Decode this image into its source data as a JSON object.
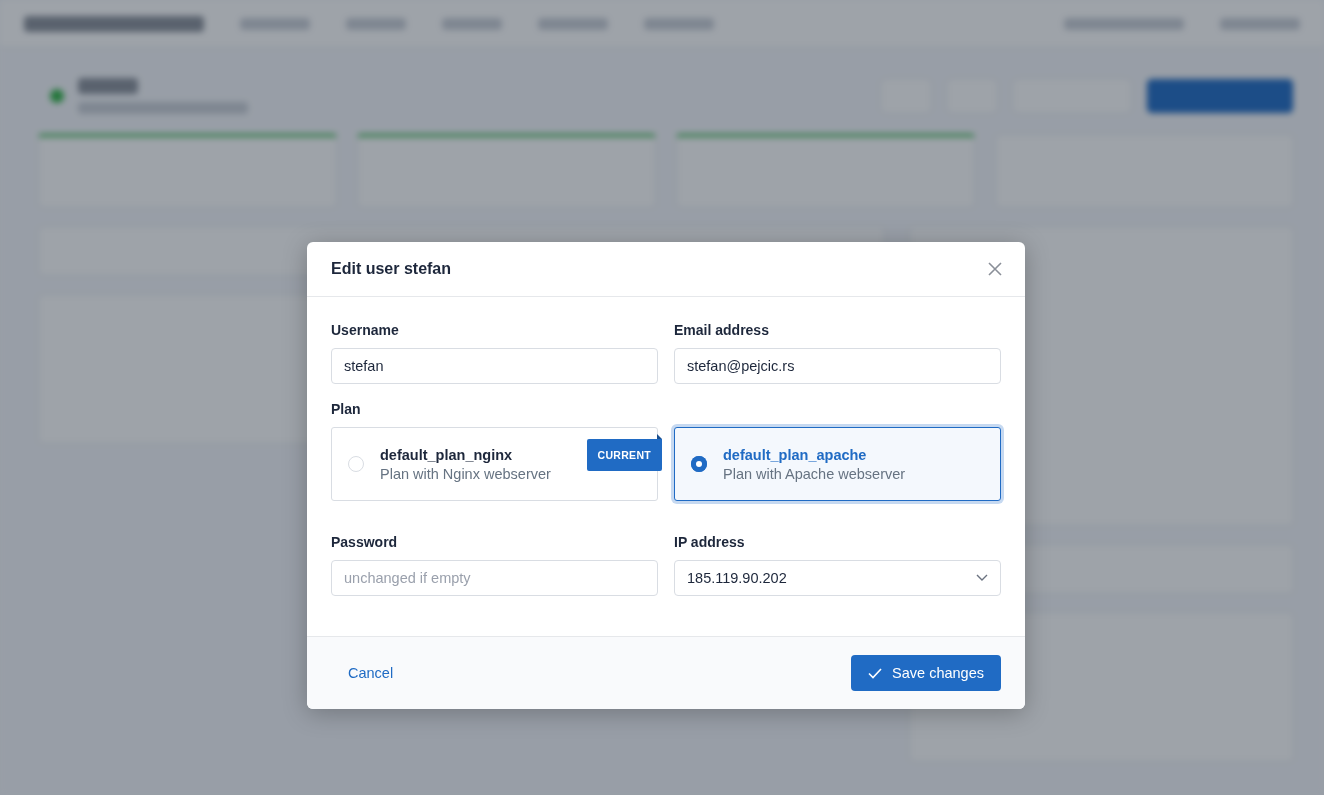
{
  "modal": {
    "title": "Edit user stefan",
    "fields": [
      {
        "kind": "text",
        "label": "Username",
        "value": "stefan"
      },
      {
        "kind": "text",
        "label": "Email address",
        "value": "stefan@pejcic.rs"
      }
    ],
    "plan": {
      "label": "Plan",
      "options": [
        {
          "name": "default_plan_nginx",
          "description": "Plan with Nginx webserver",
          "selected": false,
          "badge": "CURRENT"
        },
        {
          "name": "default_plan_apache",
          "description": "Plan with Apache webserver",
          "selected": true
        }
      ]
    },
    "fields2": [
      {
        "kind": "text",
        "label": "Password",
        "placeholder": "unchanged if empty"
      },
      {
        "kind": "select",
        "label": "IP address",
        "value": "185.119.90.202"
      }
    ],
    "cancel": "Cancel",
    "save": "Save changes"
  }
}
